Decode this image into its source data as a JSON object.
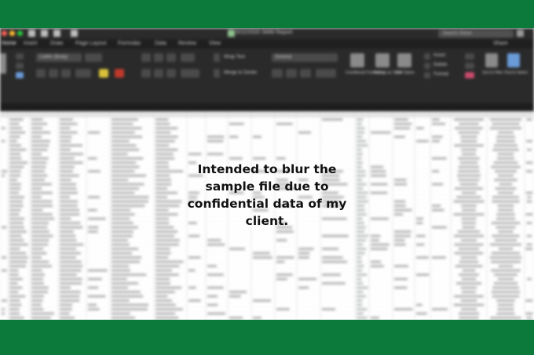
{
  "titlebar": {
    "document_title": "5/22/2020 SMM Report",
    "search_placeholder": "Search Sheet",
    "share_label": "Share"
  },
  "ribbon_tabs": [
    "Home",
    "Insert",
    "Draw",
    "Page Layout",
    "Formulas",
    "Data",
    "Review",
    "View"
  ],
  "ribbon": {
    "font_name": "Calibri (Body)",
    "wrap_text": "Wrap Text",
    "merge_center": "Merge & Center",
    "number_format": "General",
    "conditional_formatting": "Conditional Formatting",
    "format_as_table": "Format as Table",
    "cell_styles": "Cell Styles",
    "insert": "Insert",
    "delete": "Delete",
    "format": "Format",
    "sort_filter": "Sort & Filter",
    "find_select": "Find & Select"
  },
  "overlay": {
    "line1": "Intended to blur the",
    "line2": "sample file due to",
    "line3": "confidential data of my",
    "line4": "client."
  },
  "colors": {
    "frame_green": "#0b7a3b",
    "ribbon_dark": "#2a2a2a",
    "sheet_white": "#ffffff"
  }
}
